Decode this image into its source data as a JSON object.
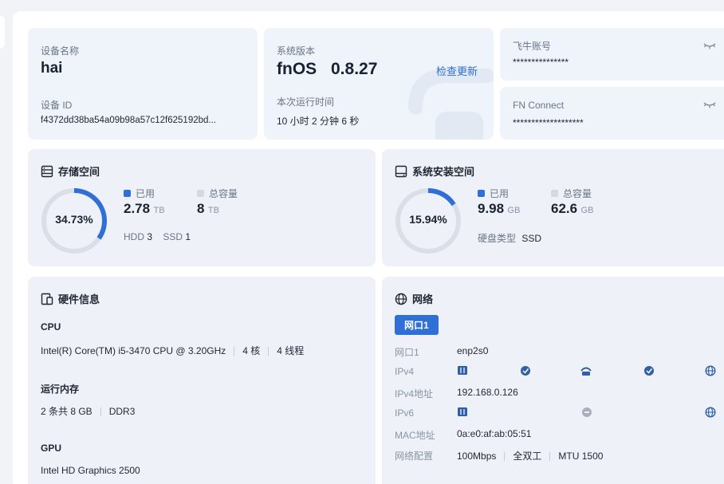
{
  "device": {
    "name_label": "设备名称",
    "name_value": "hai",
    "id_label": "设备 ID",
    "id_value": "f4372dd38ba54a09b98a57c12f625192bd..."
  },
  "system": {
    "version_label": "系统版本",
    "os_name": "fnOS",
    "os_version": "0.8.27",
    "check_update": "检查更新",
    "uptime_label": "本次运行时间",
    "uptime_value": "10 小时 2 分钟 6 秒"
  },
  "account": {
    "label": "飞牛账号",
    "value": "***************"
  },
  "fn_connect": {
    "label": "FN Connect",
    "value": "*******************"
  },
  "storage": {
    "title": "存储空间",
    "percent": "34.73%",
    "percent_value": 34.73,
    "used_label": "已用",
    "used_value": "2.78",
    "used_unit": "TB",
    "total_label": "总容量",
    "total_value": "8",
    "total_unit": "TB",
    "hdd_label": "HDD",
    "hdd_count": "3",
    "ssd_label": "SSD",
    "ssd_count": "1"
  },
  "system_storage": {
    "title": "系统安装空间",
    "percent": "15.94%",
    "percent_value": 15.94,
    "used_label": "已用",
    "used_value": "9.98",
    "used_unit": "GB",
    "total_label": "总容量",
    "total_value": "62.6",
    "total_unit": "GB",
    "disk_type_label": "硬盘类型",
    "disk_type_value": "SSD"
  },
  "hardware": {
    "title": "硬件信息",
    "cpu_label": "CPU",
    "cpu_model": "Intel(R) Core(TM) i5-3470 CPU @ 3.20GHz",
    "cpu_cores": "4 核",
    "cpu_threads": "4 线程",
    "mem_label": "运行内存",
    "mem_count": "2 条共 8 GB",
    "mem_type": "DDR3",
    "gpu_label": "GPU",
    "gpu_model": "Intel HD Graphics 2500"
  },
  "network": {
    "title": "网络",
    "tab": "网口1",
    "port_label": "网口1",
    "port_value": "enp2s0",
    "ipv4_label": "IPv4",
    "ipv4_addr_label": "IPv4地址",
    "ipv4_addr_value": "192.168.0.126",
    "ipv6_label": "IPv6",
    "mac_label": "MAC地址",
    "mac_value": "0a:e0:af:ab:05:51",
    "config_label": "网络配置",
    "speed": "100Mbps",
    "duplex": "全双工",
    "mtu": "MTU 1500"
  },
  "colors": {
    "accent": "#2f6fd6",
    "ring_track": "#d9dee7",
    "legend_total": "#d5d9e0"
  }
}
